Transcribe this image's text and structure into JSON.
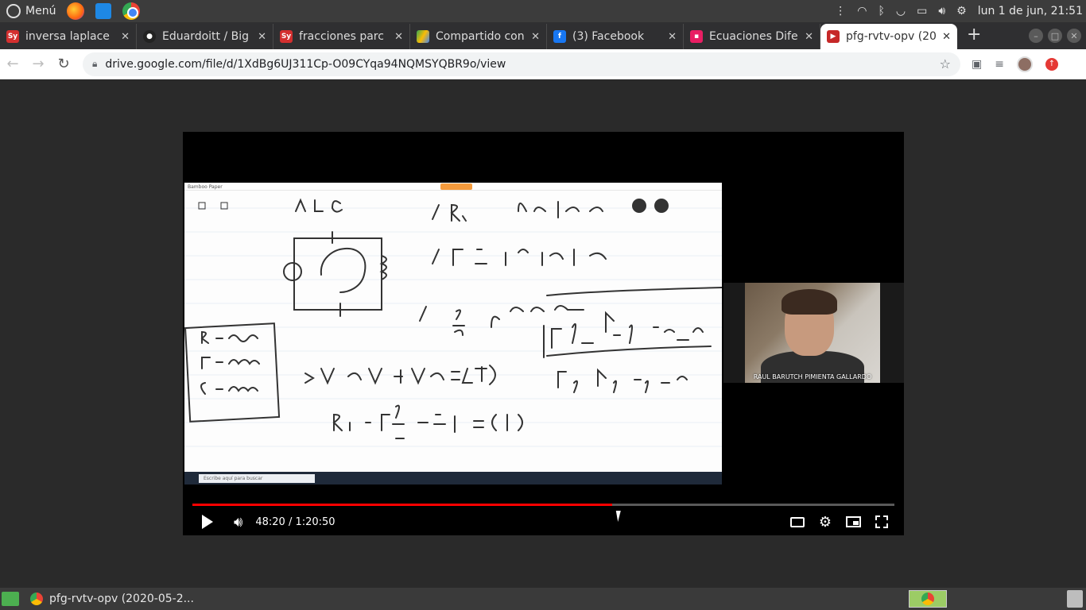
{
  "system_panel": {
    "menu_label": "Menú",
    "clock": "lun  1 de jun, 21:51"
  },
  "tabs": [
    {
      "label": "inversa laplace",
      "favicon": "symbolab-icon",
      "color": "#d32f2f"
    },
    {
      "label": "Eduardoitt / Big",
      "favicon": "github-icon",
      "color": "#222222"
    },
    {
      "label": "fracciones parc",
      "favicon": "symbolab-icon",
      "color": "#d32f2f"
    },
    {
      "label": "Compartido con",
      "favicon": "google-drive-icon",
      "color": "#fbbc05"
    },
    {
      "label": "(3) Facebook",
      "favicon": "facebook-icon",
      "color": "#1877f2"
    },
    {
      "label": "Ecuaciones Dife",
      "favicon": "doc-icon",
      "color": "#e91e63"
    },
    {
      "label": "pfg-rvtv-opv (20",
      "favicon": "video-icon",
      "color": "#c62828",
      "active": true
    }
  ],
  "toolbar": {
    "url": "drive.google.com/file/d/1XdBg6UJ311Cp-O09CYqa94NQMSYQBR9o/view"
  },
  "player": {
    "current_time": "48:20",
    "duration": "1:20:50",
    "time_display": "48:20 / 1:20:50",
    "progress_fraction": 0.598,
    "screen_share_app": "Bamboo Paper",
    "search_placeholder": "Escribe aquí para buscar",
    "webcam_name": "RAUL BARUTCH PIMIENTA GALLARDO"
  },
  "taskbar": {
    "window_title": "pfg-rvtv-opv (2020-05-2..."
  }
}
